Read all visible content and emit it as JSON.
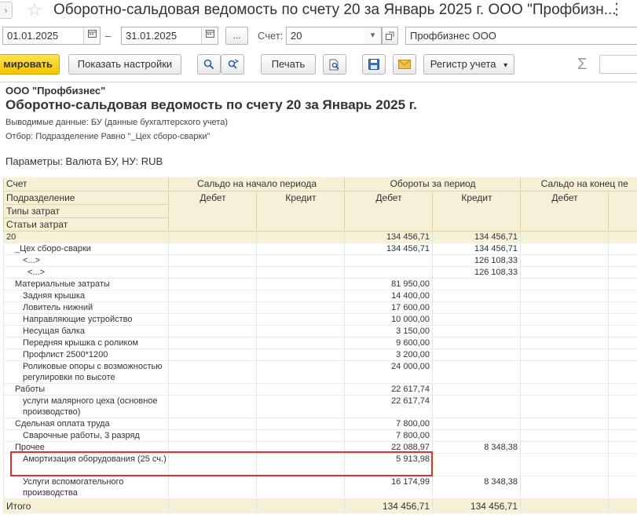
{
  "window": {
    "title": "Оборотно-сальдовая ведомость по счету 20 за Январь 2025 г. ООО \"Профбизн...",
    "forward_glyph": "›",
    "star_glyph": "☆",
    "more_glyph": "⋮"
  },
  "params": {
    "date_from": "01.01.2025",
    "dash": "–",
    "date_to": "31.01.2025",
    "period_button": "...",
    "account_label": "Счет:",
    "account_value": "20",
    "organization": "Профбизнес ООО"
  },
  "toolbar": {
    "generate_label": "мировать",
    "settings_label": "Показать настройки",
    "print_label": "Печать",
    "register_label": "Регистр учета",
    "sigma": "Σ"
  },
  "report": {
    "company": "ООО \"Профбизнес\"",
    "title": "Оборотно-сальдовая ведомость по счету 20 за Январь 2025 г.",
    "output_data": "Выводимые данные: БУ (данные бухгалтерского учета)",
    "filter": "Отбор: Подразделение Равно \"_Цех сборо-сварки\"",
    "parameters": "Параметры:     Валюта БУ, НУ: RUB",
    "headers": {
      "account": "Счет",
      "division": "Подразделение",
      "cost_types": "Типы затрат",
      "cost_items": "Статьи затрат",
      "opening": "Сальдо на начало периода",
      "turnover": "Обороты за период",
      "closing": "Сальдо на конец пе",
      "debit": "Дебет",
      "credit": "Кредит"
    },
    "rows": [
      {
        "name": "20",
        "debit": "134 456,71",
        "credit": "134 456,71"
      },
      {
        "name": "_Цех сборо-сварки",
        "debit": "134 456,71",
        "credit": "134 456,71"
      },
      {
        "name": "<...>",
        "debit": "",
        "credit": "126 108,33"
      },
      {
        "name": "<...>",
        "debit": "",
        "credit": "126 108,33"
      },
      {
        "name": "Материальные затраты",
        "debit": "81 950,00",
        "credit": ""
      },
      {
        "name": "Задняя крышка",
        "debit": "14 400,00",
        "credit": ""
      },
      {
        "name": "Ловитель нижний",
        "debit": "17 600,00",
        "credit": ""
      },
      {
        "name": "Направляющие устройство",
        "debit": "10 000,00",
        "credit": ""
      },
      {
        "name": "Несущая балка",
        "debit": "3 150,00",
        "credit": ""
      },
      {
        "name": "Передняя крышка с роликом",
        "debit": "9 600,00",
        "credit": ""
      },
      {
        "name": "Профлист 2500*1200",
        "debit": "3 200,00",
        "credit": ""
      },
      {
        "name": "Роликовые опоры с возможностью регулировки по высоте",
        "debit": "24 000,00",
        "credit": ""
      },
      {
        "name": "Работы",
        "debit": "22 617,74",
        "credit": ""
      },
      {
        "name": "услуги малярного цеха (основное производство)",
        "debit": "22 617,74",
        "credit": ""
      },
      {
        "name": "Сдельная оплата труда",
        "debit": "7 800,00",
        "credit": ""
      },
      {
        "name": "Сварочные работы, 3 разряд",
        "debit": "7 800,00",
        "credit": ""
      },
      {
        "name": "Прочее",
        "debit": "22 088,97",
        "credit": "8 348,38"
      },
      {
        "name": "Амортизация оборудования (25 сч.)",
        "debit": "5 913,98",
        "credit": ""
      },
      {
        "name": "Услуги вспомогательного производства",
        "debit": "16 174,99",
        "credit": "8 348,38"
      }
    ],
    "total": {
      "label": "Итого",
      "debit": "134 456,71",
      "credit": "134 456,71"
    }
  },
  "colors": {
    "header_bg": "#f6f0d6",
    "primary_button": "#f5c400",
    "highlight": "#e03030"
  }
}
